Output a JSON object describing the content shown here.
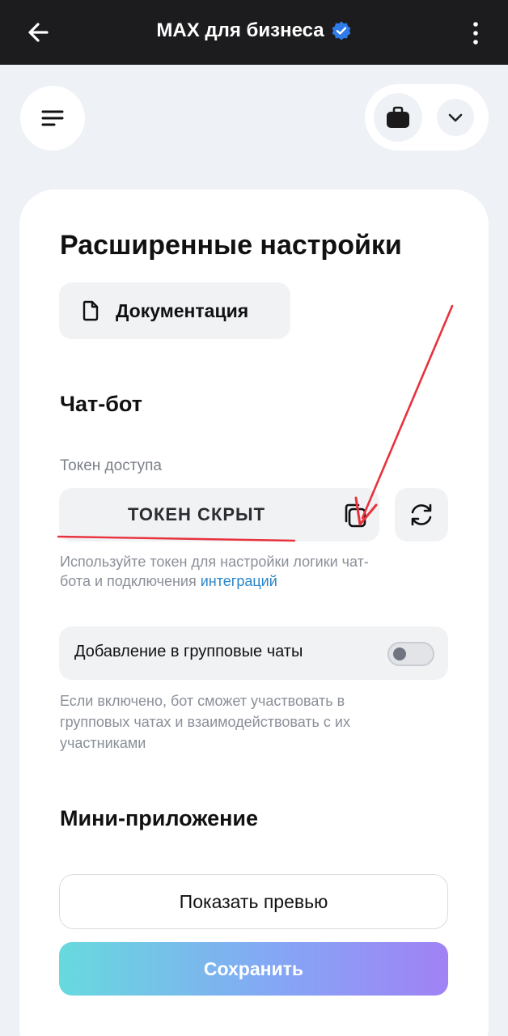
{
  "topbar": {
    "title": "MAX для бизнеса",
    "back_icon": "arrow-left-icon",
    "verified_icon": "verified-badge-icon",
    "more_icon": "more-vertical-icon"
  },
  "toolbar": {
    "menu_icon": "menu-icon",
    "bag_icon": "briefcase-icon",
    "chevron_icon": "chevron-down-icon"
  },
  "page": {
    "title": "Расширенные настройки",
    "docs_button": "Документация",
    "docs_icon": "document-icon"
  },
  "chatbot": {
    "section_title": "Чат-бот",
    "token_label": "Токен доступа",
    "token_value": "ТОКЕН СКРЫТ",
    "copy_icon": "copy-icon",
    "refresh_icon": "refresh-icon",
    "hint_text": "Используйте токен для настройки логики чат-бота и подключения",
    "hint_link": "интеграций",
    "group_toggle_label": "Добавление в групповые чаты",
    "group_toggle_on": false,
    "group_hint": "Если включено, бот сможет участвовать в групповых чатах и взаимодействовать с их участниками"
  },
  "mini_app": {
    "section_title": "Мини-приложение",
    "preview_button": "Показать превью",
    "save_button": "Сохранить"
  },
  "colors": {
    "topbar_bg": "#1c1c1e",
    "page_bg": "#eef1f5",
    "link": "#2a86c9",
    "verified": "#2f7be8",
    "annotation_red": "#e8323c",
    "save_gradient": [
      "#5fd8dc",
      "#7ea3f5",
      "#9b7bf4"
    ]
  }
}
